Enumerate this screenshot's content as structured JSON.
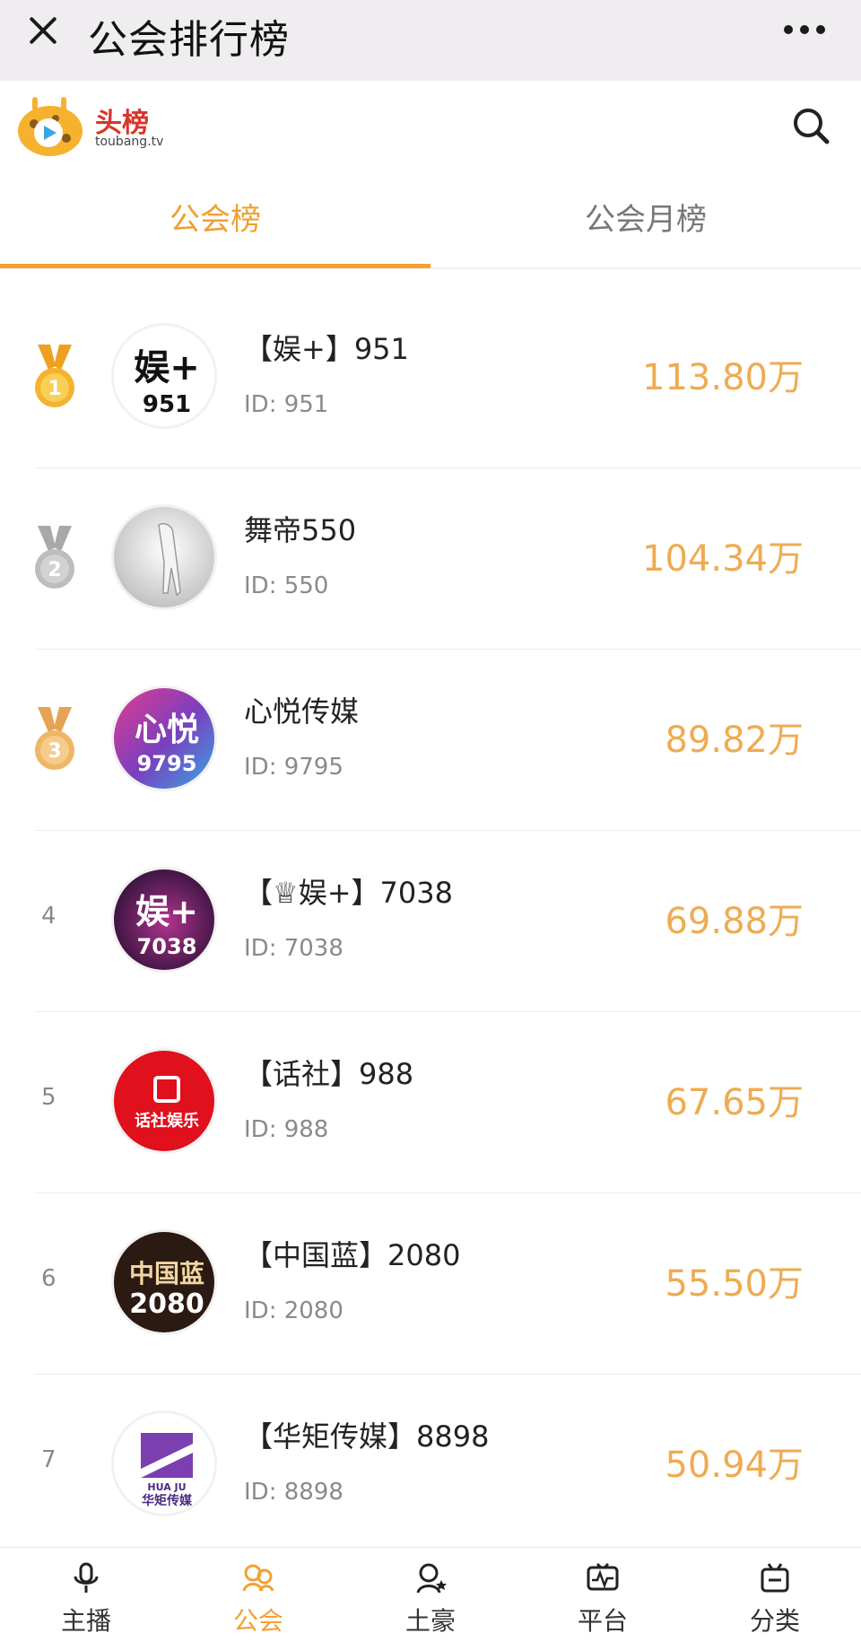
{
  "window": {
    "title": "公会排行榜"
  },
  "brand": {
    "name": "头榜",
    "domain": "toubang.tv"
  },
  "tabs": [
    {
      "label": "公会榜",
      "active": true
    },
    {
      "label": "公会月榜",
      "active": false
    }
  ],
  "colors": {
    "accent": "#f5a030",
    "score": "#efab52",
    "gold": "#f6b22f",
    "silver": "#bdbdbd",
    "bronze": "#f0b565"
  },
  "rows": [
    {
      "rank": "1",
      "medal": "gold",
      "name": "【娱+】951",
      "id": "ID: 951",
      "score": "113.80万",
      "avatar_text": "娱+",
      "avatar_sub": "951"
    },
    {
      "rank": "2",
      "medal": "silver",
      "name": "舞帝550",
      "id": "ID: 550",
      "score": "104.34万",
      "avatar_text": "",
      "avatar_sub": ""
    },
    {
      "rank": "3",
      "medal": "bronze",
      "name": "心悦传媒",
      "id": "ID: 9795",
      "score": "89.82万",
      "avatar_text": "心悦",
      "avatar_sub": "9795"
    },
    {
      "rank": "4",
      "medal": "",
      "name": "【♕娱+】7038",
      "id": "ID: 7038",
      "score": "69.88万",
      "avatar_text": "娱+",
      "avatar_sub": "7038"
    },
    {
      "rank": "5",
      "medal": "",
      "name": "【话社】988",
      "id": "ID: 988",
      "score": "67.65万",
      "avatar_text": "话社娱乐",
      "avatar_sub": ""
    },
    {
      "rank": "6",
      "medal": "",
      "name": "【中国蓝】2080",
      "id": "ID: 2080",
      "score": "55.50万",
      "avatar_text": "中国蓝",
      "avatar_sub": "2080"
    },
    {
      "rank": "7",
      "medal": "",
      "name": "【华矩传媒】8898",
      "id": "ID: 8898",
      "score": "50.94万",
      "avatar_text": "华矩传媒",
      "avatar_sub": "HUA JU"
    }
  ],
  "bottom_nav": [
    {
      "label": "主播",
      "icon": "microphone-icon",
      "active": false
    },
    {
      "label": "公会",
      "icon": "guild-icon",
      "active": true
    },
    {
      "label": "土豪",
      "icon": "tycoon-icon",
      "active": false
    },
    {
      "label": "平台",
      "icon": "platform-icon",
      "active": false
    },
    {
      "label": "分类",
      "icon": "category-icon",
      "active": false
    }
  ]
}
